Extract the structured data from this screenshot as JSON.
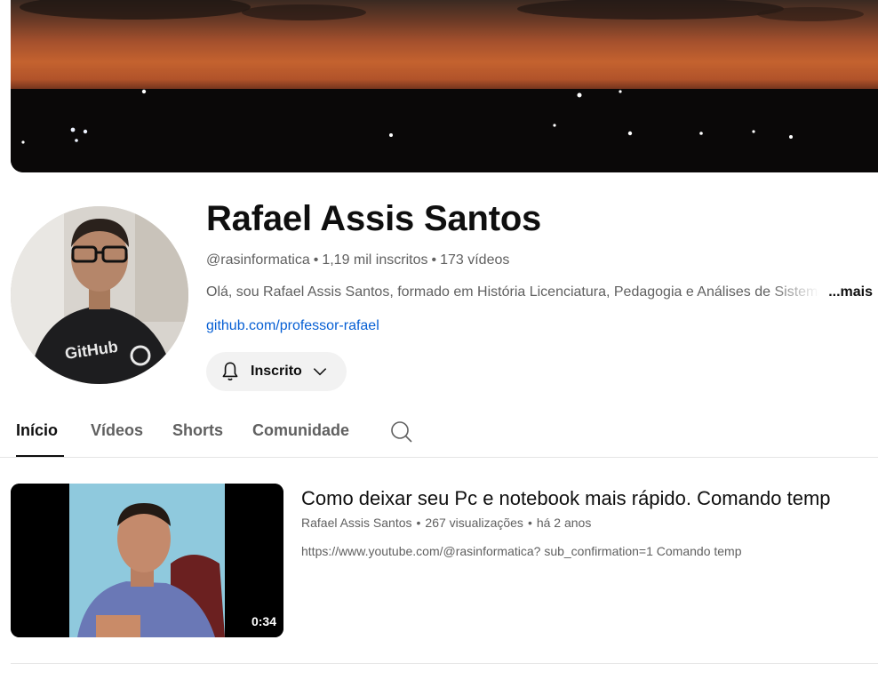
{
  "channel": {
    "name": "Rafael Assis Santos",
    "handle": "@rasinformatica",
    "subscribers": "1,19 mil inscritos",
    "videos_count": "173 vídeos",
    "separator": "•",
    "description": "Olá, sou Rafael Assis Santos, formado em História Licenciatura, Pedagogia e Análises de Sistemas",
    "more_label": "...mais",
    "link": "github.com/professor-rafael",
    "subscribe_label": "Inscrito"
  },
  "tabs": [
    {
      "label": "Início",
      "active": true
    },
    {
      "label": "Vídeos",
      "active": false
    },
    {
      "label": "Shorts",
      "active": false
    },
    {
      "label": "Comunidade",
      "active": false
    }
  ],
  "video": {
    "title": "Como deixar seu Pc e notebook mais rápido. Comando temp",
    "channel": "Rafael Assis Santos",
    "views": "267 visualizações",
    "age": "há 2 anos",
    "description": "https://www.youtube.com/@rasinformatica? sub_confirmation=1 Comando temp",
    "duration": "0:34"
  },
  "icons": {
    "bell": "bell-icon",
    "chevron": "chevron-down-icon",
    "search": "search-icon"
  },
  "colors": {
    "link": "#065fd4",
    "secondary_text": "#606060",
    "primary_text": "#0f0f0f",
    "button_bg": "#f2f2f2"
  }
}
